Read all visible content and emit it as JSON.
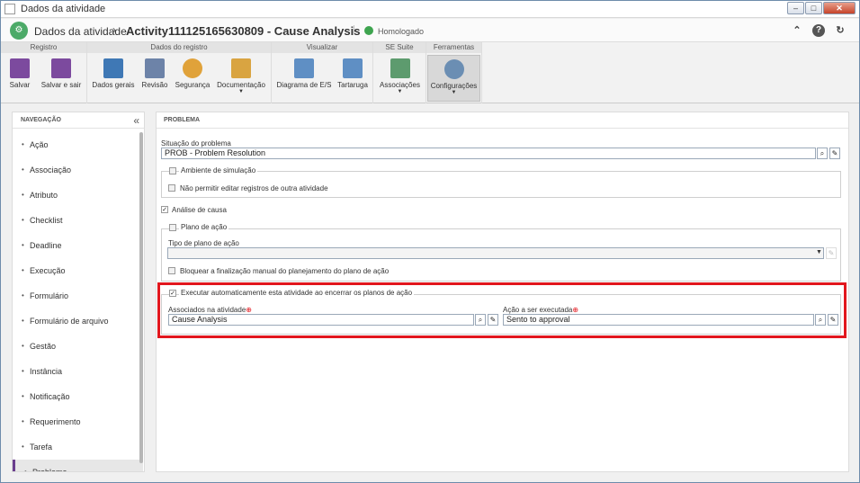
{
  "window": {
    "title": "Dados da atividade"
  },
  "header": {
    "breadcrumb": "Dados da atividade",
    "separator": "›",
    "title": "Activity111125165630809 - Cause Analysis",
    "status": "Homologado"
  },
  "ribbon": {
    "groups": [
      "Registro",
      "Dados do registro",
      "Visualizar",
      "SE Suite",
      "Ferramentas"
    ],
    "buttons": {
      "salvar": "Salvar",
      "salvar_sair": "Salvar e sair",
      "dados_gerais": "Dados gerais",
      "revisao": "Revisão",
      "seguranca": "Segurança",
      "documentacao": "Documentação",
      "diagrama": "Diagrama de E/S",
      "tartaruga": "Tartaruga",
      "associacoes": "Associações",
      "configuracoes": "Configurações"
    }
  },
  "nav": {
    "header": "NAVEGAÇÃO",
    "items": [
      "Ação",
      "Associação",
      "Atributo",
      "Checklist",
      "Deadline",
      "Execução",
      "Formulário",
      "Formulário de arquivo",
      "Gestão",
      "Instância",
      "Notificação",
      "Requerimento",
      "Tarefa",
      "Problema"
    ]
  },
  "main": {
    "header": "PROBLEMA",
    "situacao_label": "Situação do problema",
    "situacao_value": "PROB - Problem Resolution",
    "ambiente": "Ambiente de simulação",
    "nao_permitir": "Não permitir editar registros de outra atividade",
    "analise": "Análise de causa",
    "plano": "Plano de ação",
    "tipo_plano": "Tipo de plano de ação",
    "bloquear": "Bloquear a finalização manual do planejamento do plano de ação",
    "executar": "Executar automaticamente esta atividade ao encerrar os planos de ação",
    "associados_label": "Associados na atividade",
    "associados_value": "Cause Analysis",
    "acao_label": "Ação a ser executada",
    "acao_value": "Sento to approval"
  },
  "colors": {
    "accent": "#e2161d",
    "brand": "#4caa68",
    "nav_selected": "#6a3e8e"
  }
}
